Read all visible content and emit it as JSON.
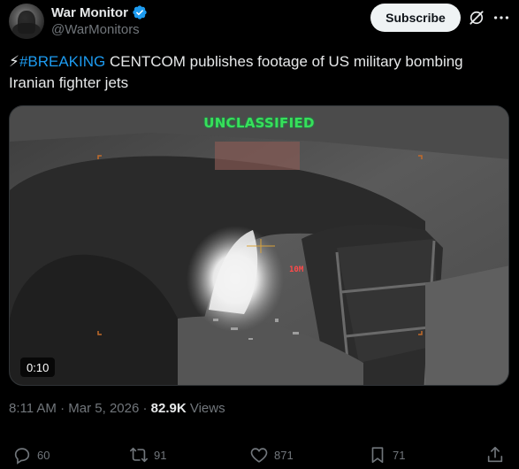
{
  "author": {
    "display_name": "War Monitor",
    "handle": "@WarMonitors",
    "verified_icon": "verified-badge-icon"
  },
  "header": {
    "subscribe_label": "Subscribe",
    "grok_icon": "grok-icon",
    "more_icon": "more-icon"
  },
  "tweet": {
    "emoji": "⚡",
    "hashtag": "#BREAKING",
    "text": " CENTCOM publishes footage of US military bombing Iranian fighter jets"
  },
  "media": {
    "overlay_label": "UNCLASSIFIED",
    "range_readout": "10M",
    "duration": "0:10"
  },
  "meta": {
    "time": "8:11 AM",
    "separator": "·",
    "date": "Mar 5, 2026",
    "views_count": "82.9K",
    "views_label": "Views"
  },
  "actions": {
    "reply_count": "60",
    "repost_count": "91",
    "like_count": "871",
    "bookmark_count": "71"
  },
  "colors": {
    "accent": "#1d9bf0",
    "background": "#000000",
    "text_primary": "#e7e9ea",
    "text_secondary": "#71767b",
    "overlay_green": "#37e05a"
  }
}
